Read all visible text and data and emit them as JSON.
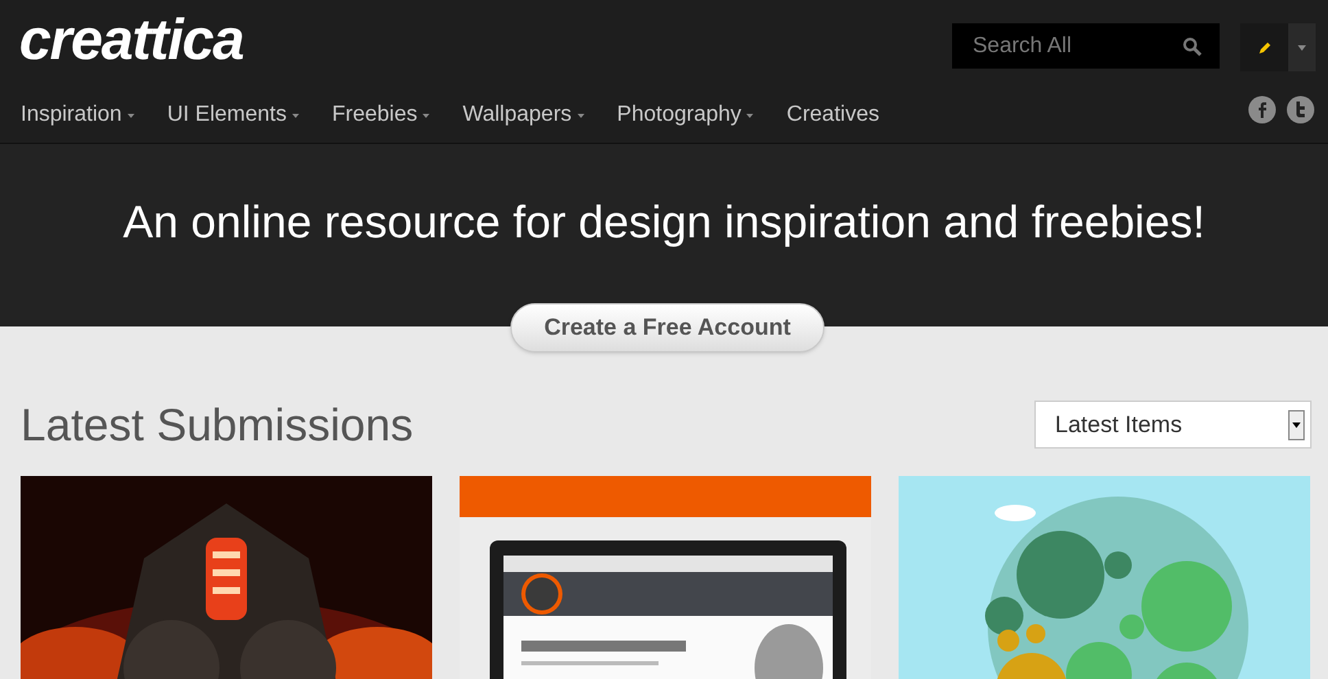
{
  "logo": "creattica",
  "search": {
    "placeholder": "Search All"
  },
  "nav": [
    {
      "label": "Inspiration",
      "has_menu": true
    },
    {
      "label": "UI Elements",
      "has_menu": true
    },
    {
      "label": "Freebies",
      "has_menu": true
    },
    {
      "label": "Wallpapers",
      "has_menu": true
    },
    {
      "label": "Photography",
      "has_menu": true
    },
    {
      "label": "Creatives",
      "has_menu": false
    }
  ],
  "hero": {
    "title": "An online resource for design inspiration and freebies!",
    "button": "Create a Free Account"
  },
  "section": {
    "title": "Latest Submissions",
    "sort": "Latest Items"
  },
  "cards": [
    {
      "kind": "fire"
    },
    {
      "kind": "template"
    },
    {
      "kind": "bubbles"
    }
  ]
}
